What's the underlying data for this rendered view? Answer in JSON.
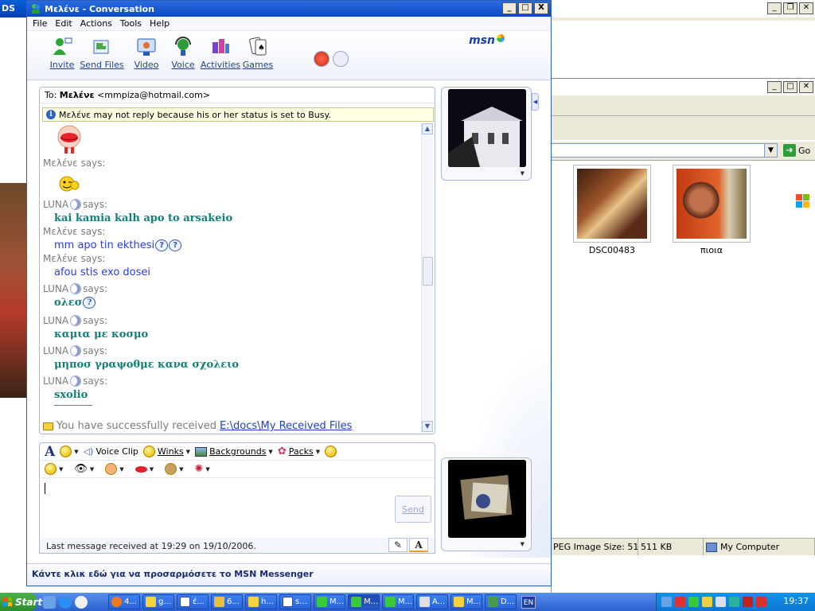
{
  "desktop": {
    "left_window_title": "DS",
    "bg_window": {
      "go_label": "Go",
      "thumbnails": [
        {
          "label": "DSC00483"
        },
        {
          "label": "πιοια"
        }
      ],
      "status": [
        "PEG Image Size: 511 KB",
        "511 KB",
        "My Computer"
      ]
    }
  },
  "window": {
    "title": "Μελένε - Conversation",
    "min": "_",
    "max": "□",
    "close": "X"
  },
  "menu": [
    "File",
    "Edit",
    "Actions",
    "Tools",
    "Help"
  ],
  "toolbar": {
    "invite": "Invite",
    "send_files": "Send Files",
    "video": "Video",
    "voice": "Voice",
    "activities": "Activities",
    "games": "Games",
    "brand": "msn"
  },
  "conversation": {
    "to_label": "To:",
    "to_name": "Μελένε",
    "to_email": "<mmpiza@hotmail.com>",
    "busy_notice": "Μελένε may not reply because his or her status is set to Busy.",
    "messages": [
      {
        "sender": "Μελένε",
        "suffix": "says:",
        "text": ""
      },
      {
        "sender": "LUNA",
        "suffix": "says:",
        "text": "kai kamia kalh apo to arsakeio"
      },
      {
        "sender": "Μελένε",
        "suffix": "says:",
        "text": "mm apo tin ekthesi"
      },
      {
        "sender": "Μελένε",
        "suffix": "says:",
        "text": "afou stis exo dosei"
      },
      {
        "sender": "LUNA",
        "suffix": "says:",
        "text": "ολεσ"
      },
      {
        "sender": "LUNA",
        "suffix": "says:",
        "text": "καμια με κοσμο"
      },
      {
        "sender": "LUNA",
        "suffix": "says:",
        "text": "μηποσ γραψοθμε κανα σχολειο"
      },
      {
        "sender": "LUNA",
        "suffix": "says:",
        "text": "sxolio"
      }
    ],
    "received_text": "You have successfully received",
    "received_link": "E:\\docs\\My Received Files"
  },
  "format_bar": {
    "font_label": "A",
    "voice_clip": "Voice Clip",
    "winks": "Winks",
    "backgrounds": "Backgrounds",
    "packs": "Packs"
  },
  "input": {
    "send_label": "Send",
    "last_message": "Last message received at 19:29 on 19/10/2006."
  },
  "customize": "Κάντε κλικ εδώ για να προσαρμόσετε το MSN Messenger",
  "taskbar": {
    "start": "Start",
    "tasks": [
      "4...",
      "g...",
      "έ...",
      "6...",
      "h...",
      "s...",
      "M...",
      "M...",
      "M...",
      "A...",
      "M...",
      "D..."
    ],
    "lang": "EN",
    "clock": "19:37"
  }
}
